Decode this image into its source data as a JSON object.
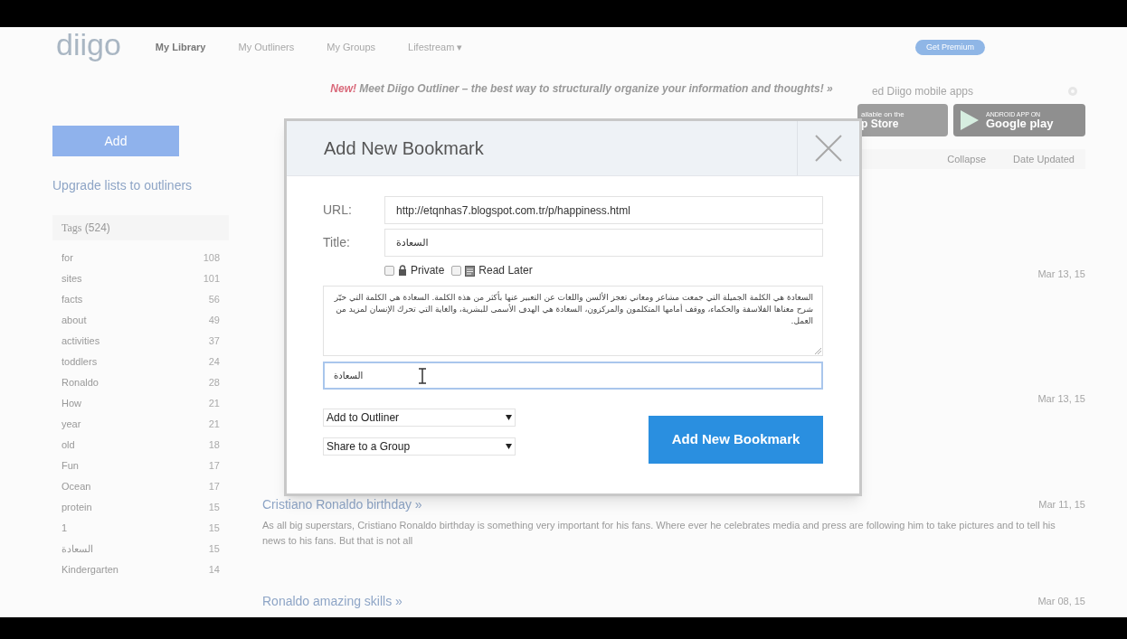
{
  "top_nav": {
    "logo": "diigo",
    "items": [
      {
        "label": "My Library",
        "selected": true
      },
      {
        "label": "My Outliners",
        "selected": false
      },
      {
        "label": "My Groups",
        "selected": false
      },
      {
        "label": "Lifestream ▾",
        "selected": false
      }
    ],
    "premium_button": "Get Premium"
  },
  "banner": {
    "new_label": "New!",
    "text": "Meet Diigo Outliner – the best way to structurally organize your information and thoughts! »"
  },
  "sidebar": {
    "add_button": "Add",
    "upgrade_link": "Upgrade lists to outliners",
    "tags_header": {
      "label": "Tags",
      "count": "(524)"
    },
    "tags": [
      {
        "name": "for",
        "count": "108"
      },
      {
        "name": "sites",
        "count": "101"
      },
      {
        "name": "facts",
        "count": "56"
      },
      {
        "name": "about",
        "count": "49"
      },
      {
        "name": "activities",
        "count": "37"
      },
      {
        "name": "toddlers",
        "count": "24"
      },
      {
        "name": "Ronaldo",
        "count": "28"
      },
      {
        "name": "How",
        "count": "21"
      },
      {
        "name": "year",
        "count": "21"
      },
      {
        "name": "old",
        "count": "18"
      },
      {
        "name": "Fun",
        "count": "17"
      },
      {
        "name": "Ocean",
        "count": "17"
      },
      {
        "name": "protein",
        "count": "15"
      },
      {
        "name": "1",
        "count": "15"
      },
      {
        "name": "السعادة",
        "count": "15"
      },
      {
        "name": "Kindergarten",
        "count": "14"
      }
    ]
  },
  "mobile_promo": {
    "text": "ed Diigo mobile apps",
    "app_store": {
      "line1": "ailable on the",
      "line2": "p Store"
    },
    "google_play": {
      "line1": "ANDROID APP ON",
      "line2": "Google play"
    }
  },
  "list_toolbar": {
    "collapse": "Collapse",
    "sort": "Date Updated"
  },
  "bookmarks": [
    {
      "date": "Mar 13, 15"
    },
    {
      "date": "Mar 13, 15"
    },
    {
      "title": "Cristiano Ronaldo birthday »",
      "date": "Mar 11, 15",
      "excerpt": "As all big superstars, Cristiano Ronaldo birthday is something very important for his fans. Where ever he celebrates media and press are following him to take pictures and to tell his news to his fans. But that is not all"
    },
    {
      "title": "Ronaldo amazing skills »",
      "date": "Mar 08, 15"
    }
  ],
  "dialog": {
    "title": "Add New Bookmark",
    "url": {
      "label": "URL:",
      "value": "http://etqnhas7.blogspot.com.tr/p/happiness.html"
    },
    "title_field": {
      "label": "Title:",
      "value": "السعادة"
    },
    "options": [
      {
        "kind": "lock",
        "label": "Private",
        "checked": false
      },
      {
        "kind": "note",
        "label": "Read Later",
        "checked": false
      }
    ],
    "description": "السعادة هي الكلمة الجميلة التي جمعت مشاعر ومعاني تعجز الألسن واللغات عن التعبير عنها بأكثر من هذه الكلمة. السعادة هي الكلمة التي حيّر شرح معناها الفلاسفة والحكماء، ووقف أمامها المتكلمون والمركزون، السعادة هي الهدف الأسمى للبشرية، والغاية التي تحرك الإنسان لمزيد من العمل.",
    "tags_value": "السعادة",
    "selects": [
      "Add to Outliner",
      "Share to a Group"
    ],
    "submit_button": "Add New Bookmark"
  }
}
